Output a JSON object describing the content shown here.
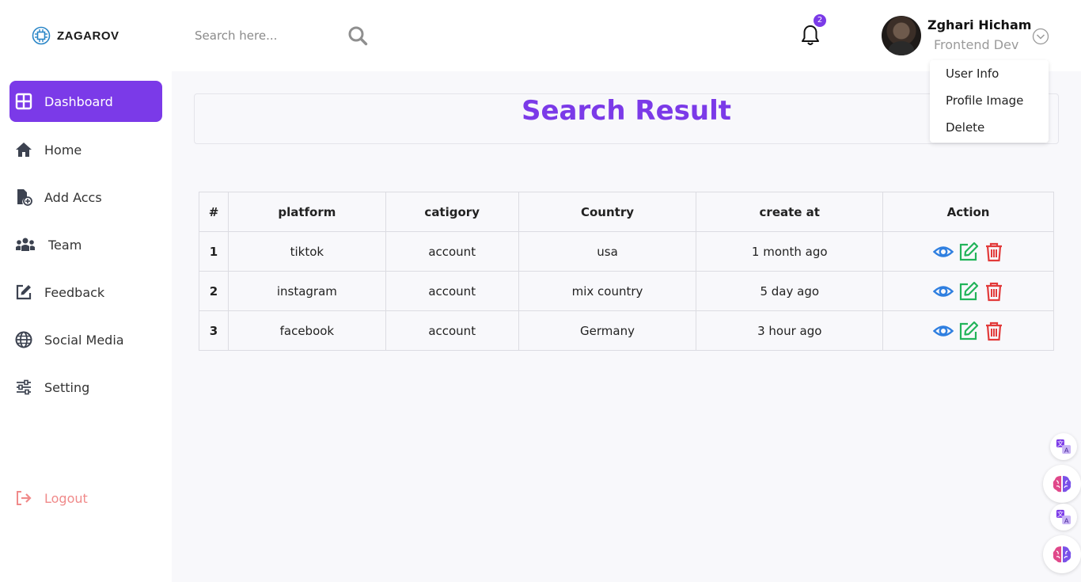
{
  "brand": {
    "name": "ZAGAROV"
  },
  "search": {
    "placeholder": "Search here..."
  },
  "notifications": {
    "count": "2"
  },
  "profile": {
    "name": "Zghari Hicham",
    "role": "Frontend Dev",
    "menu": [
      "User Info",
      "Profile Image",
      "Delete"
    ]
  },
  "sidebar": {
    "items": [
      {
        "label": "Dashboard",
        "icon": "dashboard-icon",
        "active": true
      },
      {
        "label": "Home",
        "icon": "home-icon"
      },
      {
        "label": "Add Accs",
        "icon": "add-file-icon"
      },
      {
        "label": "Team",
        "icon": "team-icon"
      },
      {
        "label": "Feedback",
        "icon": "edit-icon"
      },
      {
        "label": "Social Media",
        "icon": "globe-icon"
      },
      {
        "label": "Setting",
        "icon": "sliders-icon"
      }
    ],
    "logout": "Logout"
  },
  "main": {
    "title": "Search Result",
    "table": {
      "headers": [
        "#",
        "platform",
        "catigory",
        "Country",
        "create at",
        "Action"
      ],
      "rows": [
        {
          "num": "1",
          "platform": "tiktok",
          "category": "account",
          "country": "usa",
          "created": "1 month ago"
        },
        {
          "num": "2",
          "platform": "instagram",
          "category": "account",
          "country": "mix country",
          "created": "5 day ago"
        },
        {
          "num": "3",
          "platform": "facebook",
          "category": "account",
          "country": "Germany",
          "created": "3 hour ago"
        }
      ]
    }
  },
  "colors": {
    "accent": "#7b3ae8",
    "view": "#2f7fe0",
    "edit": "#22b45a",
    "delete": "#e23a3a",
    "logout": "#f08a8a"
  }
}
